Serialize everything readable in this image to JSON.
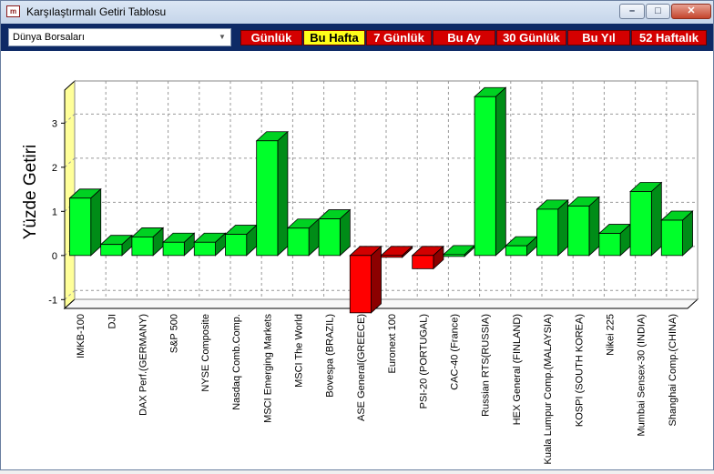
{
  "window": {
    "title": "Karşılaştırmalı Getiri Tablosu",
    "app_icon_text": "m"
  },
  "controls": {
    "minimize_glyph": "–",
    "maximize_glyph": "□",
    "close_glyph": "✕"
  },
  "market_select": {
    "value": "Dünya Borsaları",
    "arrow_glyph": "▼"
  },
  "periods": [
    {
      "label": "Günlük",
      "active": false
    },
    {
      "label": "Bu Hafta",
      "active": true
    },
    {
      "label": "7 Günlük",
      "active": false
    },
    {
      "label": "Bu Ay",
      "active": false
    },
    {
      "label": "30 Günlük",
      "active": false
    },
    {
      "label": "Bu Yıl",
      "active": false
    },
    {
      "label": "52 Haftalık",
      "active": false
    }
  ],
  "colors": {
    "positive": "#00ff2a",
    "negative": "#ff0000",
    "active_period": "#ffff1a",
    "period_button": "#d40000",
    "toolbar": "#0e2a66"
  },
  "chart_data": {
    "type": "bar",
    "ylabel": "Yüzde Getiri",
    "xlabel": "",
    "ylim": [
      -1.2,
      3.75
    ],
    "yticks": [
      -1,
      0,
      1,
      2,
      3
    ],
    "grid": true,
    "categories": [
      "IMKB-100",
      "DJI",
      "DAX Perf.(GERMANY)",
      "S&P 500",
      "NYSE Composite",
      "Nasdaq Comb.Comp.",
      "MSCI Emerging Markets",
      "MSCI The World",
      "Bovespa (BRAZIL)",
      "ASE General(GREECE)",
      "Euronext 100",
      "PSI-20 (PORTUGAL)",
      "CAC-40 (France)",
      "Russian RTS(RUSSIA)",
      "HEX General (FINLAND)",
      "Kuala Lumpur Comp.(MALAYSIA)",
      "KOSPI (SOUTH KOREA)",
      "Nikei 225",
      "Mumbai Sensex-30 (INDIA)",
      "Shanghai Comp.(CHINA)"
    ],
    "values": [
      1.3,
      0.25,
      0.42,
      0.3,
      0.3,
      0.48,
      2.6,
      0.62,
      0.83,
      -1.3,
      -0.02,
      -0.3,
      0.02,
      3.6,
      0.22,
      1.05,
      1.12,
      0.5,
      1.45,
      0.8
    ]
  }
}
